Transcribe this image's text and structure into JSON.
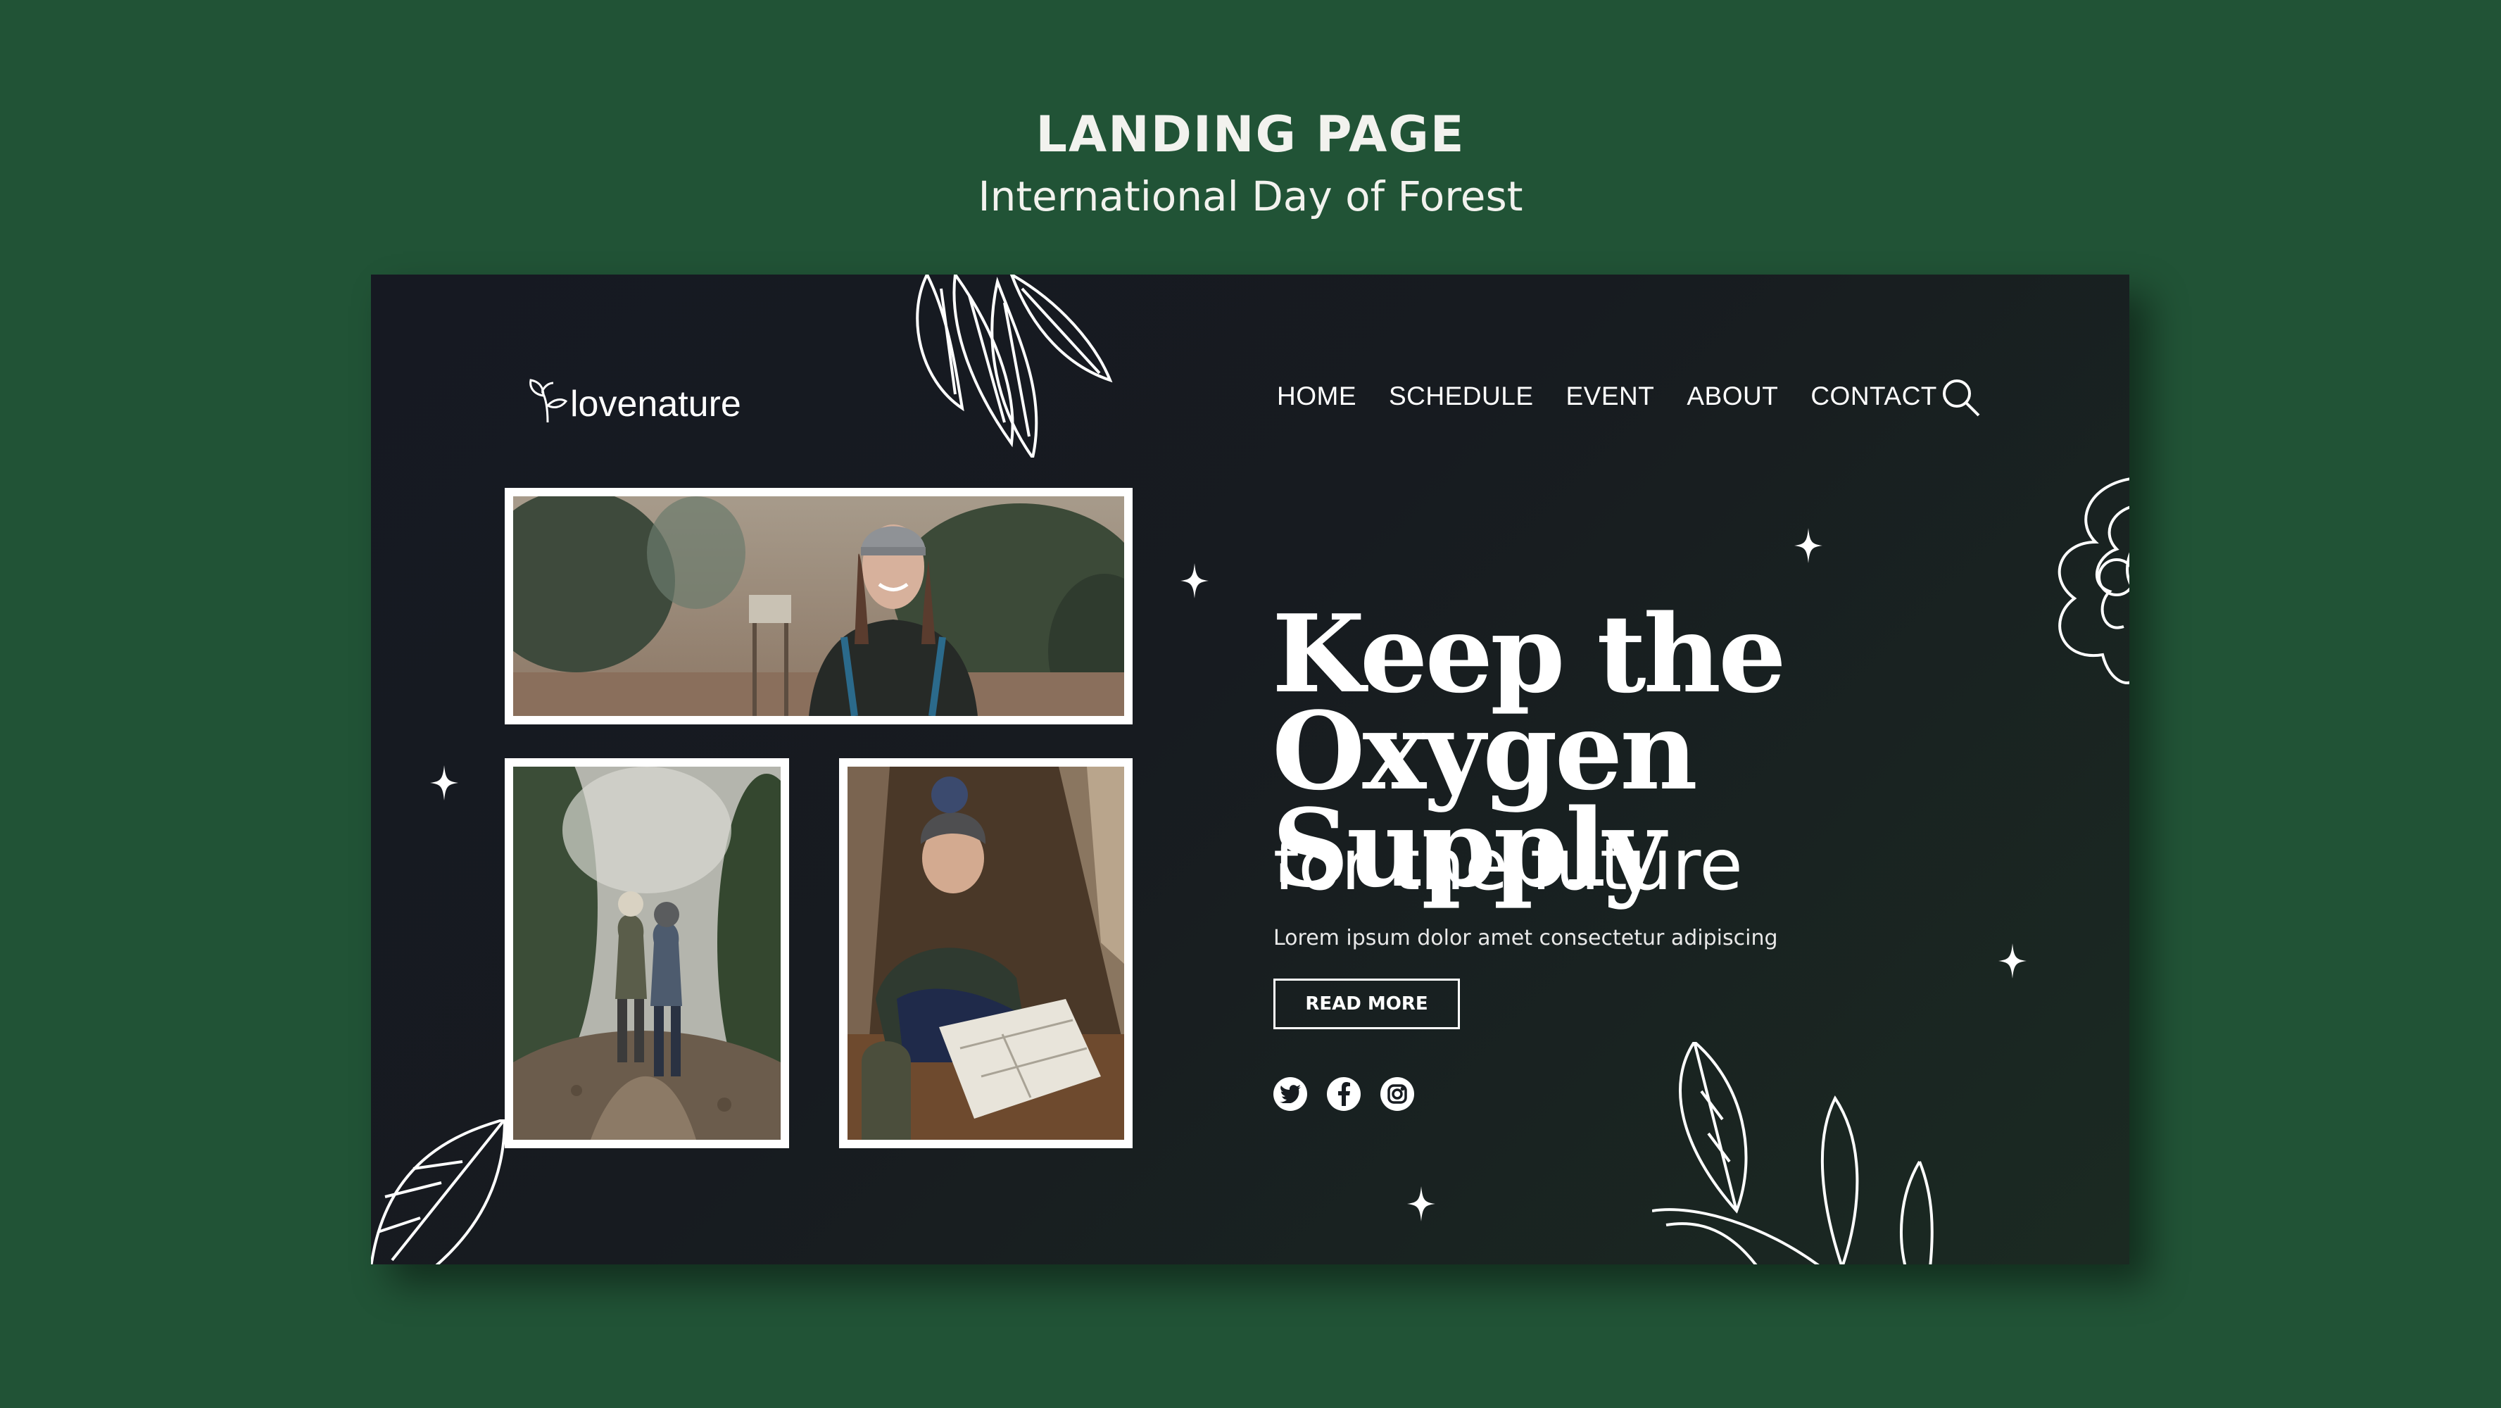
{
  "header": {
    "title": "LANDING PAGE",
    "subtitle": "International Day of Forest"
  },
  "brand": {
    "logo_text": "lovenature",
    "logo_icon": "sprout-icon"
  },
  "nav": {
    "items": [
      "HOME",
      "SCHEDULE",
      "EVENT",
      "ABOUT",
      "CONTACT"
    ],
    "search_icon": "search-icon"
  },
  "hero": {
    "headline_line1": "Keep the",
    "headline_line2": "Oxygen Supply",
    "subheadline": "for the future",
    "body": "Lorem ipsum dolor amet consectetur adipiscing",
    "cta_label": "READ MORE"
  },
  "social": {
    "icons": [
      "twitter-icon",
      "facebook-icon",
      "instagram-icon"
    ]
  },
  "colors": {
    "page_background": "#215336",
    "card_background": "#171b20",
    "text": "#ffffff"
  }
}
